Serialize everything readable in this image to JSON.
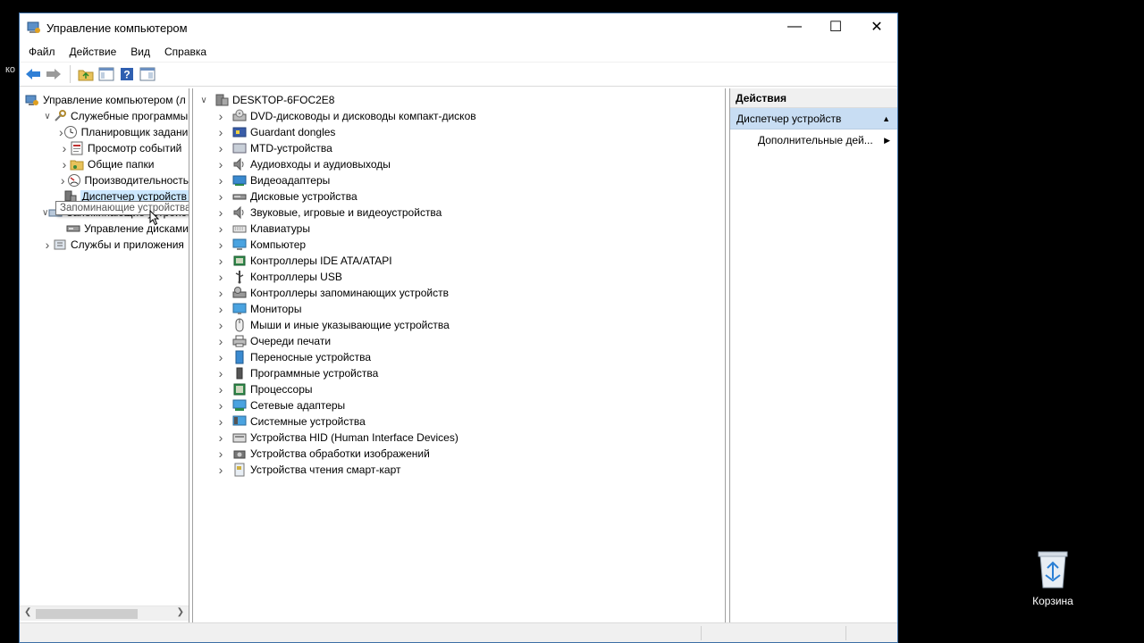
{
  "window": {
    "title": "Управление компьютером",
    "controls": {
      "minimize": "—",
      "maximize": "☐",
      "close": "✕"
    }
  },
  "menubar": [
    "Файл",
    "Действие",
    "Вид",
    "Справка"
  ],
  "left_tree": {
    "items": [
      {
        "label": "Управление компьютером (л",
        "icon": "computer-management-icon",
        "chev": "",
        "indent": 0
      },
      {
        "label": "Служебные программы",
        "icon": "tools-icon",
        "chev": "down",
        "indent": 1
      },
      {
        "label": "Планировщик заданий",
        "icon": "clock-icon",
        "chev": "right",
        "indent": 2
      },
      {
        "label": "Просмотр событий",
        "icon": "event-viewer-icon",
        "chev": "right",
        "indent": 2
      },
      {
        "label": "Общие папки",
        "icon": "shared-folder-icon",
        "chev": "right",
        "indent": 2
      },
      {
        "label": "Производительность",
        "icon": "performance-icon",
        "chev": "right",
        "indent": 2
      },
      {
        "label": "Диспетчер устройств",
        "icon": "device-manager-icon",
        "chev": "",
        "indent": 2,
        "selected": true
      },
      {
        "label": "Запоминающие устройства",
        "icon": "storage-icon",
        "chev": "down",
        "indent": 1
      },
      {
        "label": "Управление дисками",
        "icon": "disk-management-icon",
        "chev": "",
        "indent": 2
      },
      {
        "label": "Службы и приложения",
        "icon": "services-icon",
        "chev": "right",
        "indent": 1
      }
    ]
  },
  "tooltip": "Запоминающие устройства",
  "device_tree": {
    "root": "DESKTOP-6FOC2E8",
    "categories": [
      {
        "label": "DVD-дисководы и дисководы компакт-дисков",
        "icon": "dvd-drive-icon"
      },
      {
        "label": "Guardant dongles",
        "icon": "dongle-icon"
      },
      {
        "label": "MTD-устройства",
        "icon": "mtd-device-icon"
      },
      {
        "label": "Аудиовходы и аудиовыходы",
        "icon": "speaker-icon"
      },
      {
        "label": "Видеоадаптеры",
        "icon": "display-adapter-icon"
      },
      {
        "label": "Дисковые устройства",
        "icon": "disk-drive-icon"
      },
      {
        "label": "Звуковые, игровые и видеоустройства",
        "icon": "sound-icon"
      },
      {
        "label": "Клавиатуры",
        "icon": "keyboard-icon"
      },
      {
        "label": "Компьютер",
        "icon": "computer-icon"
      },
      {
        "label": "Контроллеры IDE ATA/ATAPI",
        "icon": "ide-controller-icon"
      },
      {
        "label": "Контроллеры USB",
        "icon": "usb-icon"
      },
      {
        "label": "Контроллеры запоминающих устройств",
        "icon": "storage-controller-icon"
      },
      {
        "label": "Мониторы",
        "icon": "monitor-icon"
      },
      {
        "label": "Мыши и иные указывающие устройства",
        "icon": "mouse-icon"
      },
      {
        "label": "Очереди печати",
        "icon": "printer-icon"
      },
      {
        "label": "Переносные устройства",
        "icon": "portable-device-icon"
      },
      {
        "label": "Программные устройства",
        "icon": "software-device-icon"
      },
      {
        "label": "Процессоры",
        "icon": "processor-icon"
      },
      {
        "label": "Сетевые адаптеры",
        "icon": "network-adapter-icon"
      },
      {
        "label": "Системные устройства",
        "icon": "system-device-icon"
      },
      {
        "label": "Устройства HID (Human Interface Devices)",
        "icon": "hid-icon"
      },
      {
        "label": "Устройства обработки изображений",
        "icon": "imaging-device-icon"
      },
      {
        "label": "Устройства чтения смарт-карт",
        "icon": "smart-card-icon"
      }
    ]
  },
  "actions": {
    "header": "Действия",
    "section": "Диспетчер устройств",
    "items": [
      "Дополнительные дей..."
    ]
  },
  "desktop": {
    "recycle_bin_label": "Корзина",
    "fragment": "ко"
  },
  "colors": {
    "selection": "#cce8ff",
    "action_section": "#c8ddf3",
    "window_border": "#3c6ea5"
  }
}
